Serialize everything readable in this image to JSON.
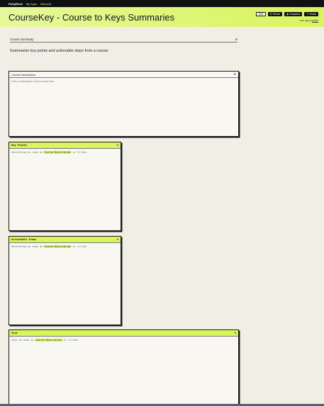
{
  "topnav": {
    "brand": "PartyRock",
    "links": [
      "My Apps",
      "Discover"
    ]
  },
  "header": {
    "title": "CourseKey - Course to Keys Summaries",
    "buttons": {
      "edit": "Edit",
      "remix": "Remix",
      "snapshot": "Snapshot",
      "share": "Share"
    },
    "owner_prefix": "Your app is",
    "owner_link": "public"
  },
  "section": {
    "title": "Course Summary",
    "subtitle": "Summarize key points and actionable steps from a course"
  },
  "widgets": {
    "description": {
      "title": "Course Description",
      "placeholder": "Enter a description of the course here"
    },
    "key_points": {
      "title": "Key Points",
      "pre": "Generating as soon as",
      "ref": "Course Description",
      "post": "is filled."
    },
    "actionable_steps": {
      "title": "Actionable Steps",
      "pre": "Generating as soon as",
      "ref": "Course Description",
      "post": "is filled."
    },
    "chat": {
      "title": "Chat",
      "pre": "Chat as soon as",
      "ref": "Course Description",
      "post": "is filled."
    }
  },
  "colors": {
    "accent": "#d9f55e",
    "header_gradient_start": "#e6f99a",
    "nav_background": "#111111",
    "page_background": "#f1efe5"
  },
  "icons": {
    "gear": "gear-icon",
    "remix": "remix-icon",
    "snapshot": "camera-icon",
    "share": "share-icon"
  }
}
